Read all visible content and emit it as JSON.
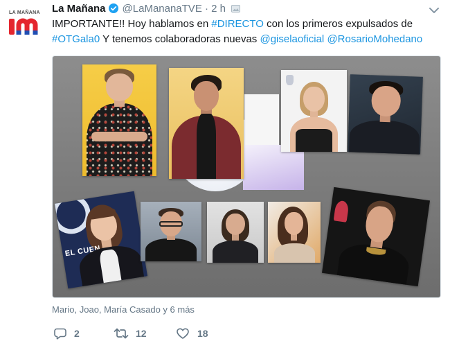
{
  "avatar": {
    "logo_text": "LA MAÑANA",
    "logo_mark": "lm"
  },
  "header": {
    "display_name": "La Mañana",
    "verified": true,
    "handle": "@LaMananaTVE",
    "separator": "·",
    "timestamp": "2 h"
  },
  "tweet": {
    "line1": {
      "text_a": "IMPORTANTE!! Hoy hablamos en",
      "hashtag": "#DIRECTO",
      "text_b": "con los primeros expulsados de"
    },
    "line2": {
      "hashtag": "#OTGala0",
      "text": "Y tenemos colaboradoras nuevas",
      "mention_1": "@giselaoficial",
      "mention_2": "@RosarioMohedano"
    }
  },
  "media": {
    "overlay_text": "EL CUEN"
  },
  "social_context": "Mario, Joao, María Casado y 6 más",
  "actions": {
    "reply_count": "2",
    "retweet_count": "12",
    "like_count": "18"
  },
  "icons": {
    "verified": "verified-badge-icon",
    "media": "media-icon",
    "menu": "chevron-down-icon",
    "reply": "reply-icon",
    "retweet": "retweet-icon",
    "like": "heart-icon"
  },
  "colors": {
    "text": "#14171a",
    "muted": "#657786",
    "link": "#1b95e0",
    "verified": "#1da1f2",
    "logo_red": "#e4262e",
    "logo_blue": "#1f4fb4"
  }
}
